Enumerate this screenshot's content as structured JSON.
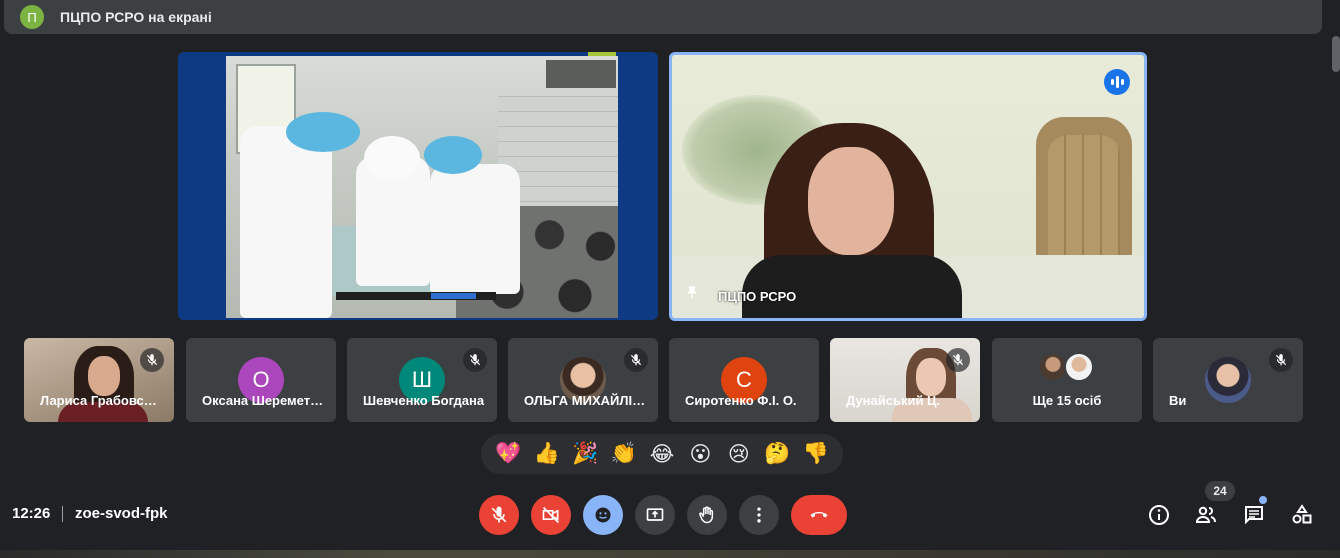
{
  "banner": {
    "avatar_letter": "П",
    "text": "ПЦПО РСРО на екрані"
  },
  "presentation": {
    "slide_alt": "presentation-slide-chefs"
  },
  "speaker": {
    "name": "ПЦПО РСРО"
  },
  "participants": [
    {
      "name": "Лариса Грабовська",
      "type": "camera"
    },
    {
      "name": "Оксана Шереметьєва",
      "type": "letter",
      "letter": "О",
      "color": "#ab47bc"
    },
    {
      "name": "Шевченко Богдана",
      "type": "letter",
      "letter": "Ш",
      "color": "#00897b"
    },
    {
      "name": "ОЛЬГА МИХАЙЛІВНА",
      "type": "photo"
    },
    {
      "name": "Сиротенко Ф.І. О.",
      "type": "letter",
      "letter": "С",
      "color": "#e0440e"
    },
    {
      "name": "Дунайський Ц.",
      "type": "camera"
    },
    {
      "name": "Ще 15 осіб",
      "type": "group"
    },
    {
      "name": "Ви",
      "type": "photo"
    }
  ],
  "reactions": [
    "💖",
    "👍",
    "🎉",
    "👏",
    "😂",
    "😮",
    "😢",
    "🤔",
    "👎"
  ],
  "bottom_bar": {
    "time": "12:26",
    "meeting_code": "zoe-svod-fpk",
    "participant_count": "24"
  },
  "colors": {
    "background": "#202124",
    "tile": "#3c4043",
    "danger": "#ea4335",
    "accent": "#8ab4f8",
    "speaking": "#1a73e8"
  }
}
